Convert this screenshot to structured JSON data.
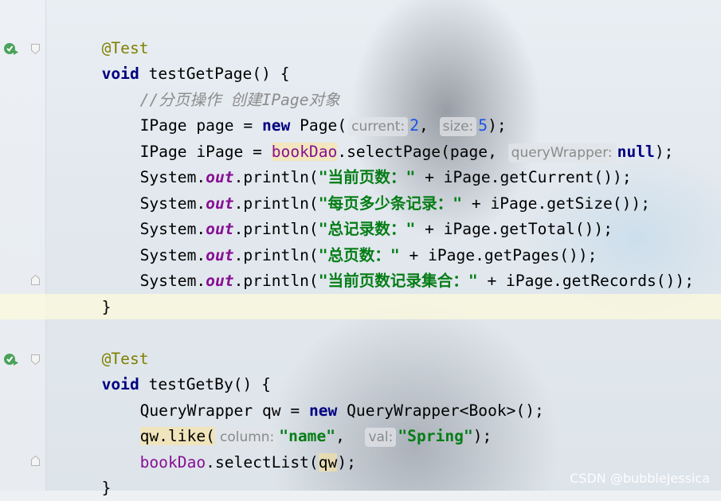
{
  "editor": {
    "lines": [
      {
        "id": "l1",
        "annotation": "@Test"
      },
      {
        "id": "l2",
        "kw": "void",
        "name": " testGetPage() {"
      },
      {
        "id": "l3",
        "comment": "//分页操作 创建IPage对象"
      },
      {
        "id": "l4",
        "p1": "IPage page = ",
        "kw": "new",
        "p2": " Page(",
        "hint1": "current:",
        "n1": "2",
        "p3": ", ",
        "hint2": "size:",
        "n2": "5",
        "p4": ");"
      },
      {
        "id": "l5",
        "p1": "IPage iPage = ",
        "member": "bookDao",
        "p2": ".selectPage(page, ",
        "hint1": "queryWrapper:",
        "kw": "null",
        "p3": ");"
      },
      {
        "id": "l6",
        "p1": "System.",
        "field": "out",
        "p2": ".println(",
        "str": "\"当前页数：\"",
        "p3": " + iPage.getCurrent());"
      },
      {
        "id": "l7",
        "p1": "System.",
        "field": "out",
        "p2": ".println(",
        "str": "\"每页多少条记录：\"",
        "p3": " + iPage.getSize());"
      },
      {
        "id": "l8",
        "p1": "System.",
        "field": "out",
        "p2": ".println(",
        "str": "\"总记录数：\"",
        "p3": " + iPage.getTotal());"
      },
      {
        "id": "l9",
        "p1": "System.",
        "field": "out",
        "p2": ".println(",
        "str": "\"总页数：\"",
        "p3": " + iPage.getPages());"
      },
      {
        "id": "l10",
        "p1": "System.",
        "field": "out",
        "p2": ".println(",
        "str": "\"当前页数记录集合：\"",
        "p3": " + iPage.getRecords());"
      },
      {
        "id": "l11",
        "p1": "}"
      },
      {
        "id": "l13",
        "annotation": "@Test"
      },
      {
        "id": "l14",
        "kw": "void",
        "name": " testGetBy() {"
      },
      {
        "id": "l15",
        "p1": "QueryWrapper qw = ",
        "kw": "new",
        "p2": " QueryWrapper<Book>();"
      },
      {
        "id": "l16",
        "p1": "qw.like(",
        "hint1": "column:",
        "str1": "\"name\"",
        "p2": ",  ",
        "hint2": "val:",
        "str2": "\"Spring\"",
        "p3": ");"
      },
      {
        "id": "l17",
        "member": "bookDao",
        "p1": ".selectList(",
        "p2": "qw",
        "p3": ");"
      },
      {
        "id": "l18",
        "p1": "}"
      }
    ]
  },
  "watermark": "CSDN @bubbleJessica",
  "colors": {
    "annotation": "#808000",
    "keyword": "#000080",
    "string": "#067d17",
    "number": "#1750eb",
    "static_field": "#871094",
    "comment": "#8c8c8c"
  }
}
